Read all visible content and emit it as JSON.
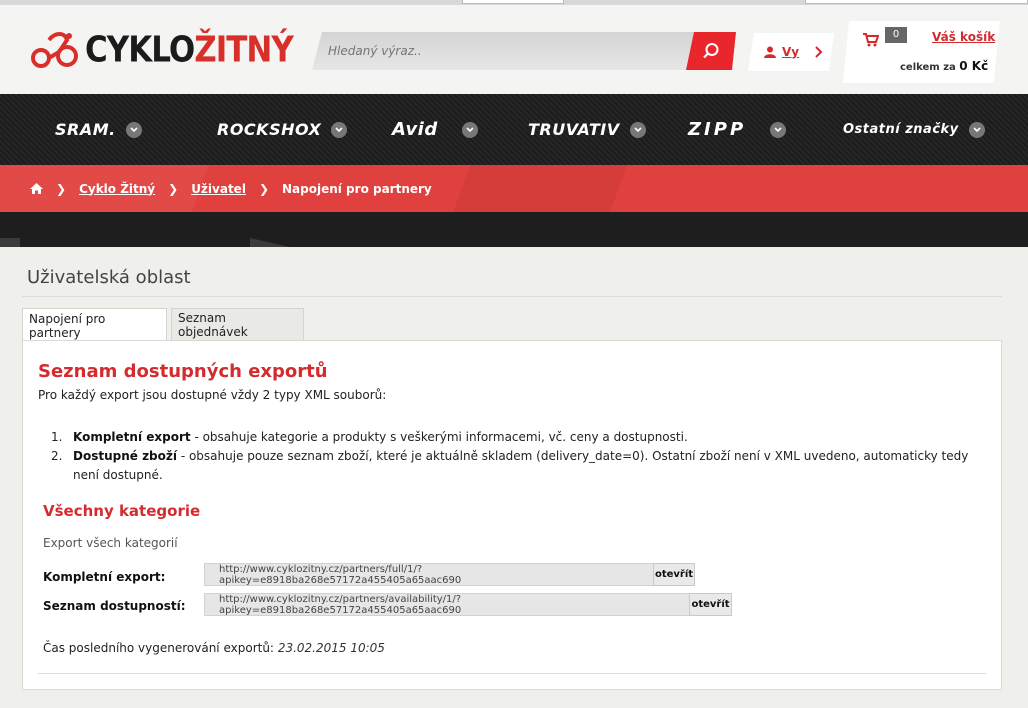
{
  "header": {
    "logo_text_a": "CYKLO",
    "logo_text_b": "ŽITNÝ",
    "search_placeholder": "Hledaný výraz..",
    "user_label": "Vy",
    "cart_count": "0",
    "cart_title": "Váš košík",
    "cart_total_label": "celkem za",
    "cart_total_value": "0 Kč"
  },
  "brands": [
    "SRAM.",
    "ROCKSHOX",
    "Avid",
    "TRUVATIV",
    "ZIPP",
    "Ostatní značky"
  ],
  "breadcrumb": {
    "items": [
      "Cyklo Žitný",
      "Uživatel"
    ],
    "current": "Napojení pro partnery"
  },
  "page": {
    "title": "Uživatelská oblast",
    "tabs": [
      "Napojení pro partnery",
      "Seznam objednávek"
    ]
  },
  "exports": {
    "heading": "Seznam dostupných exportů",
    "intro": "Pro každý export jsou dostupné vždy 2 typy XML souborů:",
    "list": [
      {
        "num": "1.",
        "bold": "Kompletní export",
        "text": " - obsahuje kategorie a produkty s veškerými informacemi, vč. ceny a dostupnosti."
      },
      {
        "num": "2.",
        "bold": "Dostupné zboží",
        "text": " - obsahuje pouze seznam zboží, které je aktuálně skladem (delivery_date=0). Ostatní zboží není v XML uvedeno, automaticky tedy není dostupné."
      }
    ],
    "section_title": "Všechny kategorie",
    "section_sub": "Export všech kategorií",
    "rows": [
      {
        "label": "Kompletní export:",
        "url": "http://www.cyklozitny.cz/partners/full/1/?apikey=e8918ba268e57172a455405a65aac690",
        "button": "otevřít"
      },
      {
        "label": "Seznam dostupností:",
        "url": "http://www.cyklozitny.cz/partners/availability/1/?apikey=e8918ba268e57172a455405a65aac690",
        "button": "otevřít"
      }
    ],
    "last_generated_label": "Čas posledního vygenerování exportů:",
    "last_generated_value": "23.02.2015 10:05"
  },
  "colors": {
    "accent": "#d42b2f",
    "header_bg": "#f4f4f2",
    "nav_bg": "#1e1e1e"
  }
}
